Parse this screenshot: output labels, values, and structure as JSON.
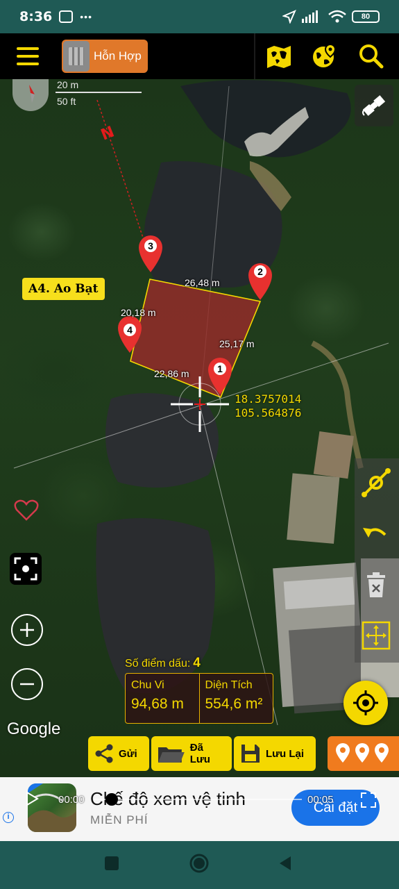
{
  "status_bar": {
    "time": "8:36",
    "battery": "80"
  },
  "toolbar": {
    "map_mode_label": "Hỗn Hợp",
    "icons": [
      "menu-icon",
      "satellite-thumb-icon",
      "world-map-icon",
      "globe-pin-icon",
      "search-icon"
    ]
  },
  "map": {
    "scale_metric": "20 m",
    "scale_imperial": "50 ft",
    "north_label": "N",
    "place_label": "A4. Ao Bạt",
    "segments": {
      "seg_3_2": "26,48 m",
      "seg_4_3": "20,18 m",
      "seg_2_1": "25,17 m",
      "seg_1_4": "22,86 m"
    },
    "markers": [
      "1",
      "2",
      "3",
      "4"
    ],
    "coordinates": {
      "lat": "18.3757014",
      "lon": "105.564876"
    },
    "attribution": "Google"
  },
  "stats": {
    "points_label": "Số điểm dấu:",
    "points_value": "4",
    "perimeter_label": "Chu Vi",
    "perimeter_value": "94,68 m",
    "area_label": "Diện Tích",
    "area_value": "554,6 m²"
  },
  "actions": {
    "send": "Gửi",
    "saved": "Đã Lưu",
    "save": "Lưu Lại"
  },
  "ad": {
    "video_elapsed": "00:00",
    "video_remaining": "00:05",
    "title": "Chế độ xem vệ tinh",
    "subtitle": "MIỄN PHÍ",
    "cta": "Cài đặt"
  },
  "colors": {
    "accent_yellow": "#f4d800",
    "accent_orange": "#e0782a",
    "polygon_fill": "#9e2a2a",
    "teal_bar": "#1f5a55",
    "cta_blue": "#1a73e8"
  }
}
